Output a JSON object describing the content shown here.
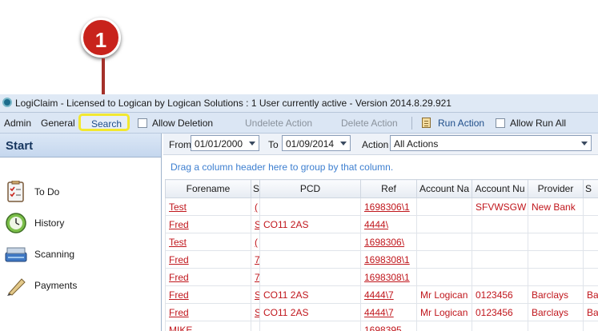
{
  "callout": {
    "number": "1"
  },
  "window": {
    "title": "LogiClaim - Licensed to Logican by Logican Solutions : 1 User currently active - Version 2014.8.29.921"
  },
  "menu": {
    "admin": "Admin",
    "general": "General",
    "search": "Search",
    "allow_deletion": "Allow Deletion",
    "undelete_action": "Undelete Action",
    "delete_action": "Delete Action",
    "run_action": "Run Action",
    "allow_run_all": "Allow Run All"
  },
  "sidebar": {
    "title": "Start",
    "items": [
      {
        "label": "To Do",
        "icon": "checklist-icon"
      },
      {
        "label": "History",
        "icon": "clock-icon"
      },
      {
        "label": "Scanning",
        "icon": "scanner-icon"
      },
      {
        "label": "Payments",
        "icon": "pen-icon"
      }
    ]
  },
  "filters": {
    "from_label": "From",
    "from_value": "01/01/2000",
    "to_label": "To",
    "to_value": "01/09/2014",
    "action_label": "Action",
    "action_value": "All Actions"
  },
  "grid": {
    "group_hint": "Drag a column header here to group by that column.",
    "columns": [
      "Forename",
      "S",
      "PCD",
      "Ref",
      "Account Na",
      "Account Nu",
      "Provider",
      "S"
    ],
    "rows": [
      [
        "Test",
        "(",
        "",
        "1698306\\1",
        "",
        "SFVWSGW",
        "New Bank",
        ""
      ],
      [
        "Fred",
        "S",
        "CO11 2AS",
        "4444\\",
        "",
        "",
        "",
        ""
      ],
      [
        "Test",
        "(",
        "",
        "1698306\\",
        "",
        "",
        "",
        ""
      ],
      [
        "Fred",
        "7",
        "",
        "1698308\\1",
        "",
        "",
        "",
        ""
      ],
      [
        "Fred",
        "7",
        "",
        "1698308\\1",
        "",
        "",
        "",
        ""
      ],
      [
        "Fred",
        "S",
        "CO11 2AS",
        "4444\\7",
        "Mr Logican",
        "0123456",
        "Barclays",
        "Bar"
      ],
      [
        "Fred",
        "S",
        "CO11 2AS",
        "4444\\7",
        "Mr Logican",
        "0123456",
        "Barclays",
        "Bar"
      ],
      [
        "MIKE",
        "",
        "",
        "1698395",
        "",
        "",
        "",
        ""
      ]
    ]
  },
  "colors": {
    "accent": "#c8231c",
    "highlight": "#f2e830",
    "link": "#3d7fd0",
    "row_text": "#c0161c"
  }
}
